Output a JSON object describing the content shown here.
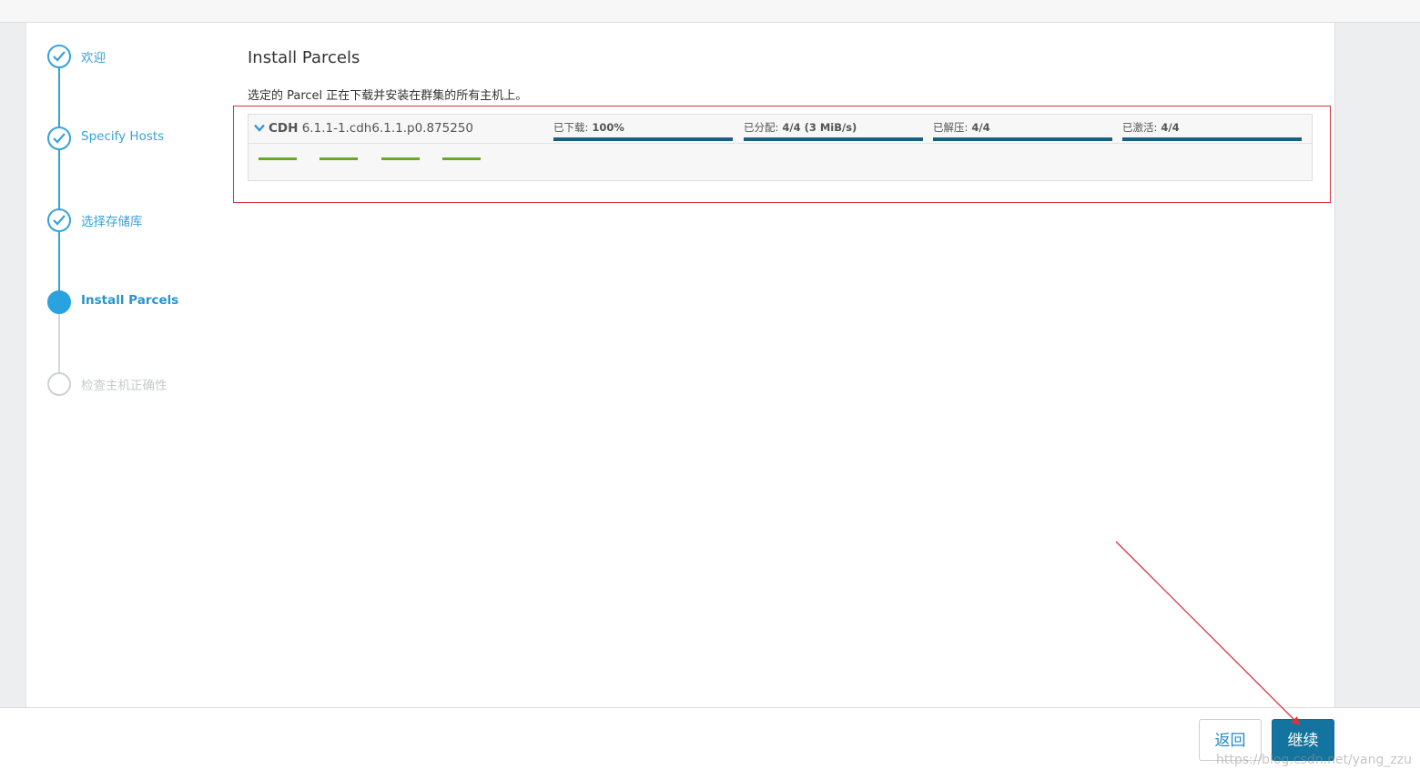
{
  "steps": [
    {
      "label": "欢迎",
      "state": "done"
    },
    {
      "label": "Specify Hosts",
      "state": "done"
    },
    {
      "label": "选择存储库",
      "state": "done"
    },
    {
      "label": "Install Parcels",
      "state": "active"
    },
    {
      "label": "检查主机正确性",
      "state": "pending"
    }
  ],
  "main": {
    "title": "Install Parcels",
    "subtitle": "选定的 Parcel 正在下载并安装在群集的所有主机上。",
    "parcel": {
      "name_prefix": "CDH",
      "name_version": "6.1.1-1.cdh6.1.1.p0.875250",
      "stages": [
        {
          "label": "已下载:",
          "value": "100%",
          "progress": 1.0
        },
        {
          "label": "已分配:",
          "value": "4/4 (3 MiB/s)",
          "progress": 1.0
        },
        {
          "label": "已解压:",
          "value": "4/4",
          "progress": 1.0
        },
        {
          "label": "已激活:",
          "value": "4/4",
          "progress": 1.0
        }
      ]
    }
  },
  "footer": {
    "back_label": "返回",
    "continue_label": "继续",
    "watermark": "https://blog.csdn.net/yang_zzu"
  },
  "colors": {
    "accent": "#37a2d8",
    "active_step": "#29a3e0",
    "progress_bar": "#1b5f7e",
    "host_dash": "#68a829",
    "highlight_border": "#d9333f",
    "continue_button": "#12749f"
  }
}
